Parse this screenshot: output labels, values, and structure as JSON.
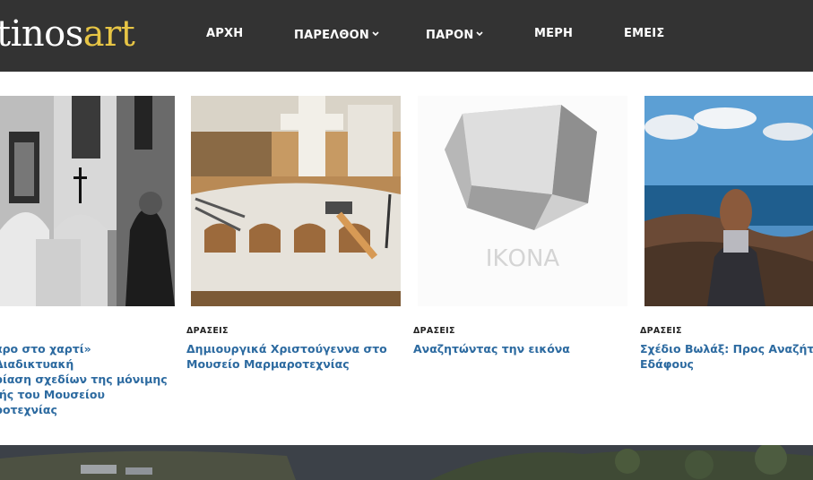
{
  "header": {
    "logo_part1": "tinos",
    "logo_part2": "art",
    "nav": [
      {
        "label": "ΑΡΧΗ",
        "has_dropdown": false
      },
      {
        "label": "ΠΑΡΕΛΘΟΝ",
        "has_dropdown": true
      },
      {
        "label": "ΠΑΡΟΝ",
        "has_dropdown": true
      },
      {
        "label": "ΜΕΡΗ",
        "has_dropdown": false
      },
      {
        "label": "ΕΜΕΙΣ",
        "has_dropdown": false
      }
    ],
    "colors": {
      "bar": "#333333",
      "accent": "#e7c545"
    }
  },
  "cards": [
    {
      "category": "",
      "title_lines": [
        "αρο στο χαρτί» Διαδικτυακή",
        "ρίαση σχεδίων της μόνιμης",
        "ιής του Μουσείου",
        "ροτεχνίας"
      ]
    },
    {
      "category": "ΔΡΑΣΕΙΣ",
      "title_lines": [
        "Δημιουργικά Χριστούγεννα στο",
        "Μουσείο Μαρμαροτεχνίας"
      ]
    },
    {
      "category": "ΔΡΑΣΕΙΣ",
      "title_lines": [
        "Αναζητώντας την εικόνα"
      ],
      "image_caption": "ΙΚΟΝΑ"
    },
    {
      "category": "ΔΡΑΣΕΙΣ",
      "title_lines": [
        "Σχέδιο Βωλάξ: Προς Αναζήτησ",
        "Εδάφους"
      ]
    }
  ],
  "title_color": "#2c6aa0"
}
